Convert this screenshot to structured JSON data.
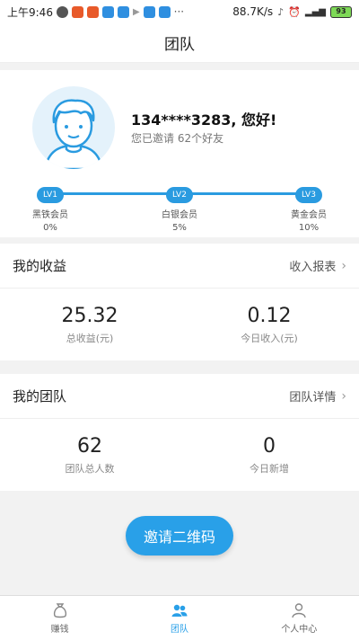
{
  "status_bar": {
    "time": "上午9:46",
    "net_speed": "88.7K/s",
    "battery": "93"
  },
  "header": {
    "title": "团队"
  },
  "profile": {
    "username": "134****3283, 您好!",
    "invite_text": "您已邀请 62个好友",
    "levels": [
      {
        "badge": "LV1",
        "name": "黑铁会员",
        "pct": "0%"
      },
      {
        "badge": "LV2",
        "name": "白银会员",
        "pct": "5%"
      },
      {
        "badge": "LV3",
        "name": "黄金会员",
        "pct": "10%"
      }
    ]
  },
  "earnings": {
    "title": "我的收益",
    "link": "收入报表",
    "stats": [
      {
        "value": "25.32",
        "label": "总收益(元)"
      },
      {
        "value": "0.12",
        "label": "今日收入(元)"
      }
    ]
  },
  "team": {
    "title": "我的团队",
    "link": "团队详情",
    "stats": [
      {
        "value": "62",
        "label": "团队总人数"
      },
      {
        "value": "0",
        "label": "今日新增"
      }
    ]
  },
  "invite_button": "邀请二维码",
  "tabs": [
    {
      "label": "赚钱",
      "icon": "money-bag-icon"
    },
    {
      "label": "团队",
      "icon": "team-icon",
      "active": true
    },
    {
      "label": "个人中心",
      "icon": "person-icon"
    }
  ],
  "colors": {
    "accent": "#29a0e8",
    "level_line": "#2a9be0"
  }
}
